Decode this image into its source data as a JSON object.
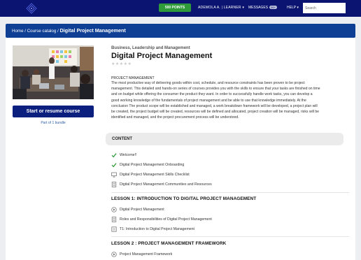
{
  "topbar": {
    "points_label": "500 POINTS",
    "user_label": "ADEMOLA A. | LEARNER",
    "messages_label": "MESSAGES",
    "messages_count": "99+",
    "help_label": "HELP",
    "search_placeholder": "Search"
  },
  "breadcrumb": {
    "home": "Home",
    "sep1": " / ",
    "catalog": "Course catalog",
    "sep2": " / ",
    "current": "Digital Project Management"
  },
  "course": {
    "category": "Business, Leadership and Management",
    "title": "Digital Project Management",
    "stars": "★★★★★",
    "cta_label": "Start or resume course",
    "bundle_label": "Part of 1 bundle",
    "desc_heading": "PROJECT MANAGEMENT",
    "description": "The most productive way of delivering goods within cost, schedule, and resource constraints has been proven to be project management. This detailed and hands-on series of courses provides you with the skills to ensure that your tasks are finished on time and on budget while offering the consumer the product they want. In order to successfully handle work tasks, you can develop a good working knowledge of the fundamentals of project management and be able to use that knowledge immediately. At the conclusion The product scope will be established and managed, a work breakdown framework will be developed, a project plan will be created, the project budget will be created, resources will be defined and allocated, project creation will be managed, risks will be identified and managed, and the project procurement process will be understood."
  },
  "content": {
    "heading": "CONTENT",
    "intro_items": [
      {
        "label": "Welcome!!",
        "icon": "check-icon"
      },
      {
        "label": "Digital Project Management Onboarding",
        "icon": "check-icon"
      },
      {
        "label": "Digital Project Management Skills Checklist",
        "icon": "monitor-icon"
      },
      {
        "label": "Digital Project Management Communities and Resources",
        "icon": "document-icon"
      }
    ],
    "lesson1": {
      "title": "LESSON 1: INTRODUCTION TO DIGITAL PROJECT MANAGEMENT",
      "items": [
        {
          "label": "Digital Project Management",
          "icon": "play-icon"
        },
        {
          "label": "Roles and Responsibilities of Digital Project Management",
          "icon": "document-icon"
        },
        {
          "label": "T1: Introduction to Digital Project Management",
          "icon": "test-icon"
        }
      ]
    },
    "lesson2": {
      "title": "LESSON 2 : PROJECT MANAGEMENT FRAMEWORK",
      "items": [
        {
          "label": "Project Management Framework",
          "icon": "play-icon"
        }
      ]
    }
  },
  "colors": {
    "topbar": "#0b1470",
    "breadcrumb": "#0f3f95",
    "points": "#2f9a3a",
    "cta": "#0b1f7e",
    "check": "#2f9a3a"
  }
}
